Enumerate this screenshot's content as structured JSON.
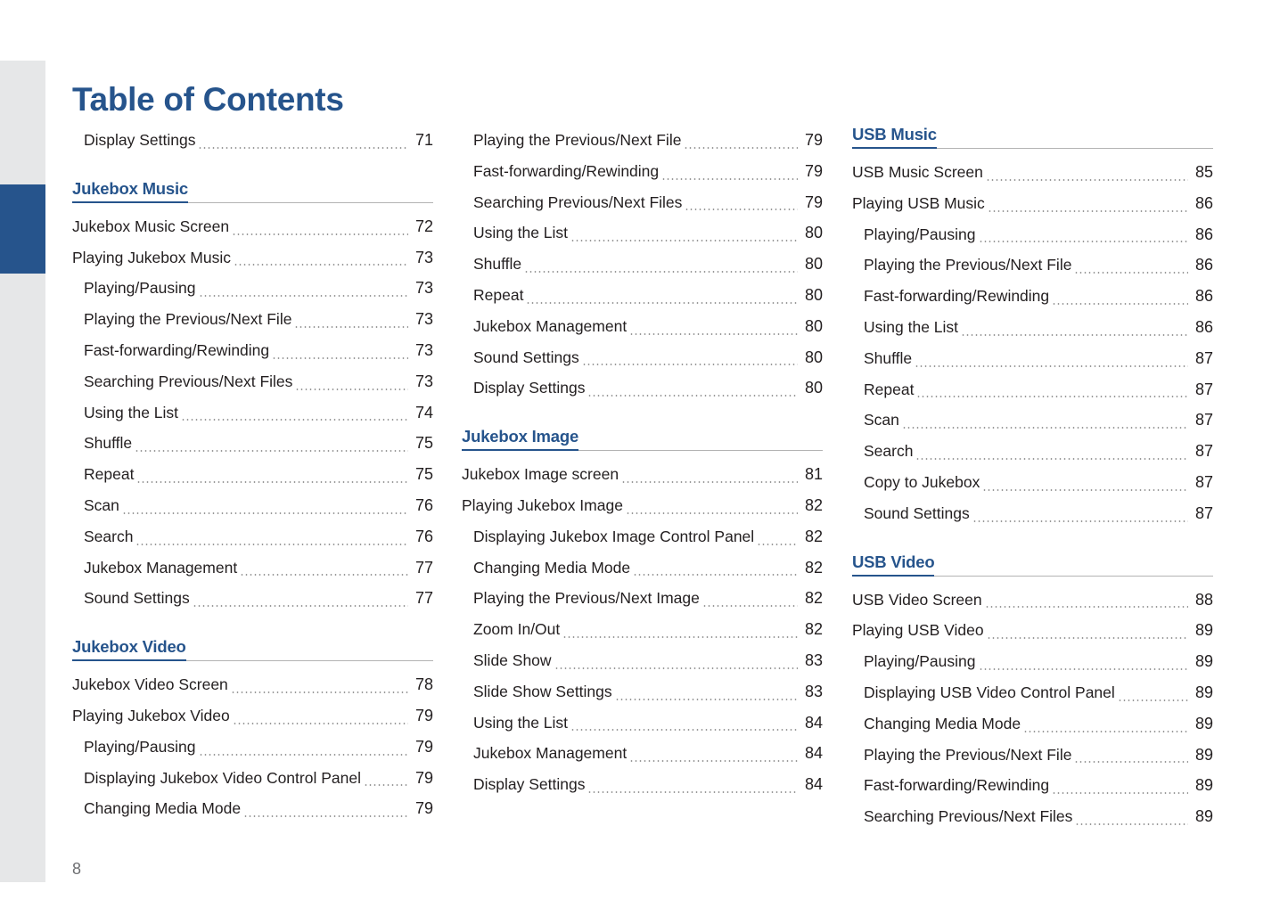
{
  "document": {
    "title": "Table of Contents",
    "page_number": "8",
    "accent_color": "#26548c",
    "text_color": "#231f20",
    "rule_color": "#b3b3b3",
    "strip_color": "#e6e7e8"
  },
  "edge_tab": {
    "name": "active-chapter-tab",
    "color": "#26548c"
  },
  "columns": [
    {
      "id": "column-1",
      "blocks": [
        {
          "type": "entries",
          "entries": [
            {
              "label": "Display Settings",
              "page": "71",
              "level": 2
            }
          ]
        },
        {
          "type": "section",
          "heading": "Jukebox Music",
          "entries": [
            {
              "label": "Jukebox Music Screen",
              "page": "72",
              "level": 1
            },
            {
              "label": "Playing Jukebox Music",
              "page": "73",
              "level": 1
            },
            {
              "label": "Playing/Pausing",
              "page": "73",
              "level": 2
            },
            {
              "label": "Playing the Previous/Next File",
              "page": "73",
              "level": 2
            },
            {
              "label": "Fast-forwarding/Rewinding",
              "page": "73",
              "level": 2
            },
            {
              "label": "Searching Previous/Next Files",
              "page": "73",
              "level": 2
            },
            {
              "label": "Using the List",
              "page": "74",
              "level": 2
            },
            {
              "label": "Shuffle",
              "page": "75",
              "level": 2
            },
            {
              "label": "Repeat",
              "page": "75",
              "level": 2
            },
            {
              "label": "Scan",
              "page": "76",
              "level": 2
            },
            {
              "label": "Search",
              "page": "76",
              "level": 2
            },
            {
              "label": "Jukebox Management",
              "page": "77",
              "level": 2
            },
            {
              "label": "Sound Settings",
              "page": "77",
              "level": 2
            }
          ]
        },
        {
          "type": "section",
          "heading": "Jukebox Video",
          "entries": [
            {
              "label": "Jukebox Video Screen",
              "page": "78",
              "level": 1
            },
            {
              "label": "Playing Jukebox Video",
              "page": "79",
              "level": 1
            },
            {
              "label": "Playing/Pausing",
              "page": "79",
              "level": 2
            },
            {
              "label": "Displaying Jukebox Video Control Panel",
              "page": "79",
              "level": 2
            },
            {
              "label": "Changing Media Mode",
              "page": "79",
              "level": 2
            }
          ]
        }
      ]
    },
    {
      "id": "column-2",
      "blocks": [
        {
          "type": "entries",
          "entries": [
            {
              "label": "Playing the Previous/Next File",
              "page": "79",
              "level": 2
            },
            {
              "label": "Fast-forwarding/Rewinding",
              "page": "79",
              "level": 2
            },
            {
              "label": "Searching Previous/Next Files",
              "page": "79",
              "level": 2
            },
            {
              "label": "Using the List",
              "page": "80",
              "level": 2
            },
            {
              "label": "Shuffle",
              "page": "80",
              "level": 2
            },
            {
              "label": "Repeat",
              "page": "80",
              "level": 2
            },
            {
              "label": "Jukebox Management",
              "page": "80",
              "level": 2
            },
            {
              "label": "Sound Settings",
              "page": "80",
              "level": 2
            },
            {
              "label": "Display Settings",
              "page": "80",
              "level": 2
            }
          ]
        },
        {
          "type": "section",
          "heading": "Jukebox Image",
          "entries": [
            {
              "label": "Jukebox Image screen",
              "page": "81",
              "level": 1
            },
            {
              "label": "Playing Jukebox Image",
              "page": "82",
              "level": 1
            },
            {
              "label": "Displaying Jukebox Image Control Panel",
              "page": "82",
              "level": 2
            },
            {
              "label": "Changing Media Mode",
              "page": "82",
              "level": 2
            },
            {
              "label": "Playing the Previous/Next Image",
              "page": "82",
              "level": 2
            },
            {
              "label": "Zoom In/Out",
              "page": "82",
              "level": 2
            },
            {
              "label": "Slide Show",
              "page": "83",
              "level": 2
            },
            {
              "label": "Slide Show Settings",
              "page": "83",
              "level": 2
            },
            {
              "label": "Using the List",
              "page": "84",
              "level": 2
            },
            {
              "label": "Jukebox Management",
              "page": "84",
              "level": 2
            },
            {
              "label": "Display Settings",
              "page": "84",
              "level": 2
            }
          ]
        }
      ]
    },
    {
      "id": "column-3",
      "blocks": [
        {
          "type": "section",
          "heading": "USB Music",
          "first": true,
          "entries": [
            {
              "label": "USB Music Screen",
              "page": "85",
              "level": 1
            },
            {
              "label": "Playing USB Music",
              "page": "86",
              "level": 1
            },
            {
              "label": "Playing/Pausing",
              "page": "86",
              "level": 2
            },
            {
              "label": "Playing the Previous/Next File",
              "page": "86",
              "level": 2
            },
            {
              "label": "Fast-forwarding/Rewinding",
              "page": "86",
              "level": 2
            },
            {
              "label": "Using the List",
              "page": "86",
              "level": 2
            },
            {
              "label": "Shuffle",
              "page": "87",
              "level": 2
            },
            {
              "label": "Repeat",
              "page": "87",
              "level": 2
            },
            {
              "label": "Scan",
              "page": "87",
              "level": 2
            },
            {
              "label": "Search",
              "page": "87",
              "level": 2
            },
            {
              "label": "Copy to Jukebox",
              "page": "87",
              "level": 2
            },
            {
              "label": "Sound Settings",
              "page": "87",
              "level": 2
            }
          ]
        },
        {
          "type": "section",
          "heading": "USB Video",
          "entries": [
            {
              "label": "USB Video Screen",
              "page": "88",
              "level": 1
            },
            {
              "label": "Playing USB Video",
              "page": "89",
              "level": 1
            },
            {
              "label": "Playing/Pausing",
              "page": "89",
              "level": 2
            },
            {
              "label": "Displaying USB Video Control Panel",
              "page": "89",
              "level": 2
            },
            {
              "label": "Changing Media Mode",
              "page": "89",
              "level": 2
            },
            {
              "label": "Playing the Previous/Next File",
              "page": "89",
              "level": 2
            },
            {
              "label": "Fast-forwarding/Rewinding",
              "page": "89",
              "level": 2
            },
            {
              "label": "Searching Previous/Next Files",
              "page": "89",
              "level": 2
            }
          ]
        }
      ]
    }
  ]
}
